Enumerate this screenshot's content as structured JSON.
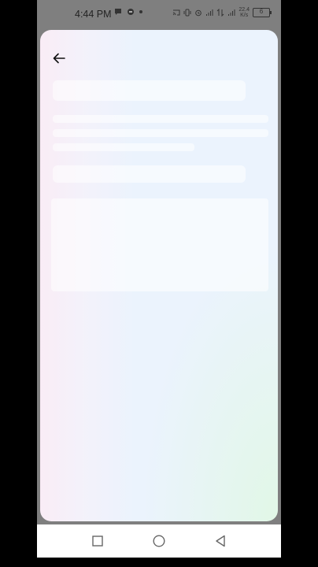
{
  "status_bar": {
    "time": "4:44 PM",
    "net_speed_top": "22.4",
    "net_speed_bottom": "K/s",
    "signal_label": "4G",
    "battery_level": "6"
  },
  "icons": {
    "back": "arrow-left-icon",
    "recents": "square-icon",
    "home": "circle-icon",
    "back_nav": "triangle-left-icon"
  },
  "colors": {
    "sheet_bg": "#ebf3fd",
    "overlay": "#7f7f7f",
    "nav_bg": "#ffffff"
  }
}
